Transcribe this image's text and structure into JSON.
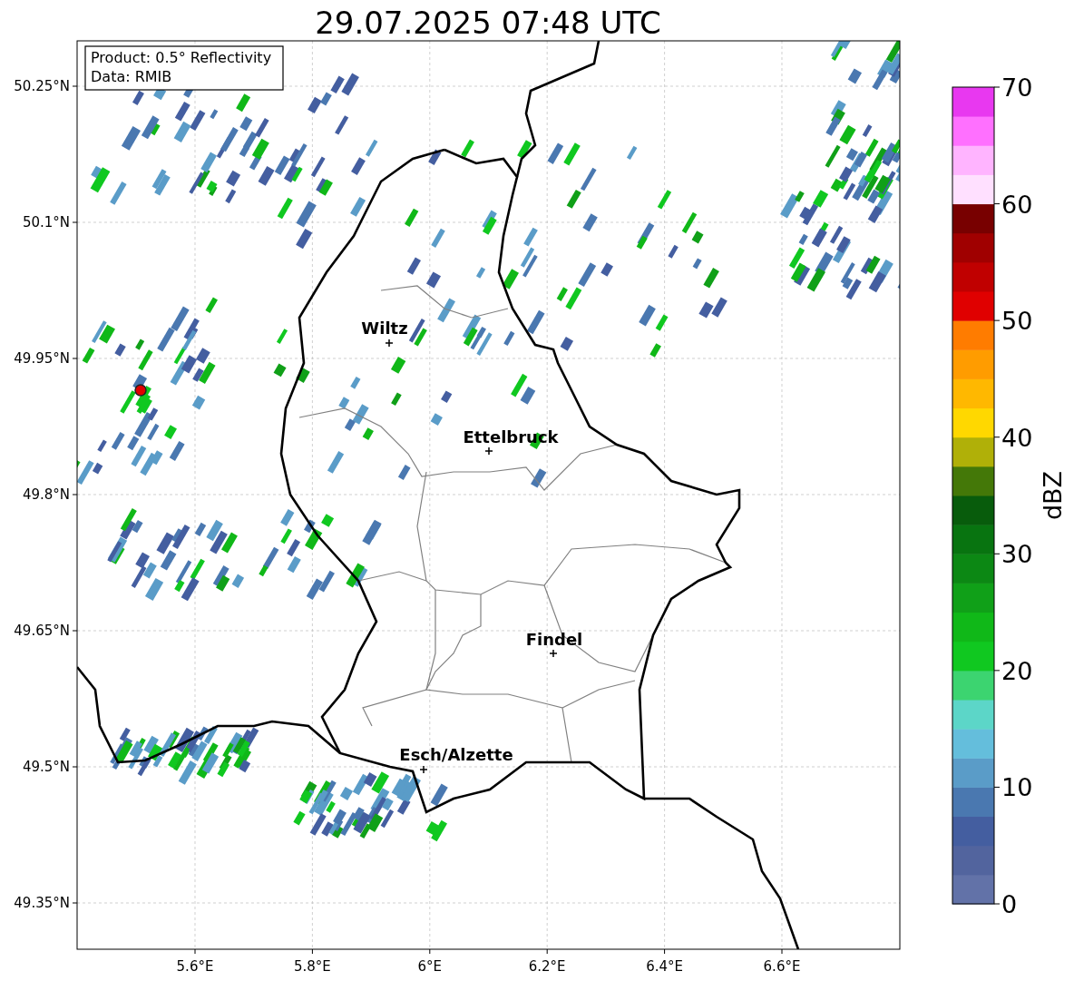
{
  "title": "29.07.2025 07:48 UTC",
  "info_box": [
    "Product: 0.5° Reflectivity",
    "Data: RMIB"
  ],
  "cities": [
    {
      "name": "Wiltz"
    },
    {
      "name": "Ettelbruck"
    },
    {
      "name": "Findel"
    },
    {
      "name": "Esch/Alzette"
    }
  ],
  "x_ticks": [
    "5.6°E",
    "5.8°E",
    "6°E",
    "6.2°E",
    "6.4°E",
    "6.6°E"
  ],
  "y_ticks": [
    "50.25°N",
    "50.1°N",
    "49.95°N",
    "49.8°N",
    "49.65°N",
    "49.5°N",
    "49.35°N"
  ],
  "colorbar": {
    "label": "dBZ",
    "ticks": [
      "70",
      "60",
      "50",
      "40",
      "30",
      "20",
      "10",
      "0"
    ]
  }
}
